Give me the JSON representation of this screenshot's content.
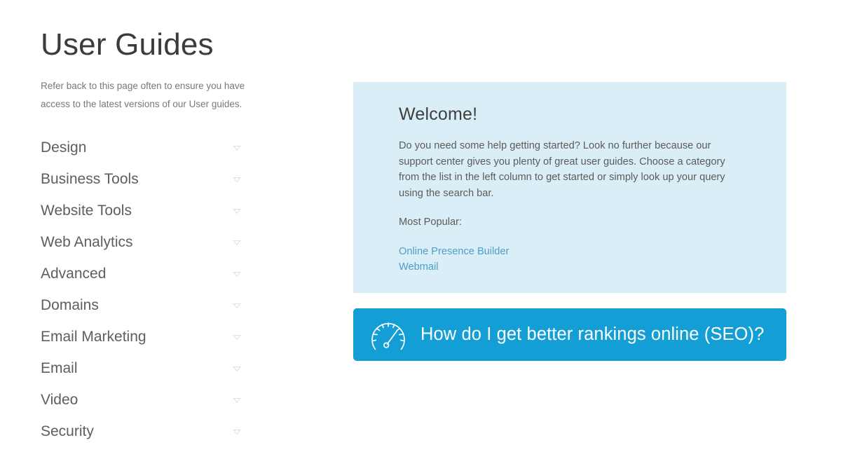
{
  "sidebar": {
    "title": "User Guides",
    "intro": "Refer back to this page often to ensure you have access to the latest versions of our User guides.",
    "categories": [
      {
        "label": "Design",
        "icon": "caret-down-icon"
      },
      {
        "label": "Business Tools",
        "icon": "caret-down-icon"
      },
      {
        "label": "Website Tools",
        "icon": "caret-down-icon"
      },
      {
        "label": "Web Analytics",
        "icon": "caret-down-icon"
      },
      {
        "label": "Advanced",
        "icon": "caret-down-icon"
      },
      {
        "label": "Domains",
        "icon": "caret-down-icon"
      },
      {
        "label": "Email Marketing",
        "icon": "caret-down-icon"
      },
      {
        "label": "Email",
        "icon": "caret-down-icon"
      },
      {
        "label": "Video",
        "icon": "caret-down-icon"
      },
      {
        "label": "Security",
        "icon": "caret-down-icon"
      }
    ]
  },
  "main": {
    "welcome": {
      "heading": "Welcome!",
      "body": "Do you need some help getting started? Look no further because our support center gives you plenty of great user guides. Choose a category from the list in the left column to get started or simply look up your query using the search bar.",
      "most_popular_label": "Most Popular:",
      "popular_links": [
        {
          "label": "Online Presence Builder"
        },
        {
          "label": "Webmail"
        }
      ]
    },
    "seo_banner": {
      "label": "How do I get better rankings online (SEO)?",
      "icon": "speedometer-icon"
    }
  },
  "colors": {
    "panel_background": "#daeef7",
    "banner_background": "#139fd6",
    "link": "#4c9fc6",
    "heading": "#3b3b3b",
    "body_text": "#5b5b5b",
    "category_label": "#5e5e5e",
    "caret": "#e0e0e0",
    "page_background": "#ffffff"
  }
}
